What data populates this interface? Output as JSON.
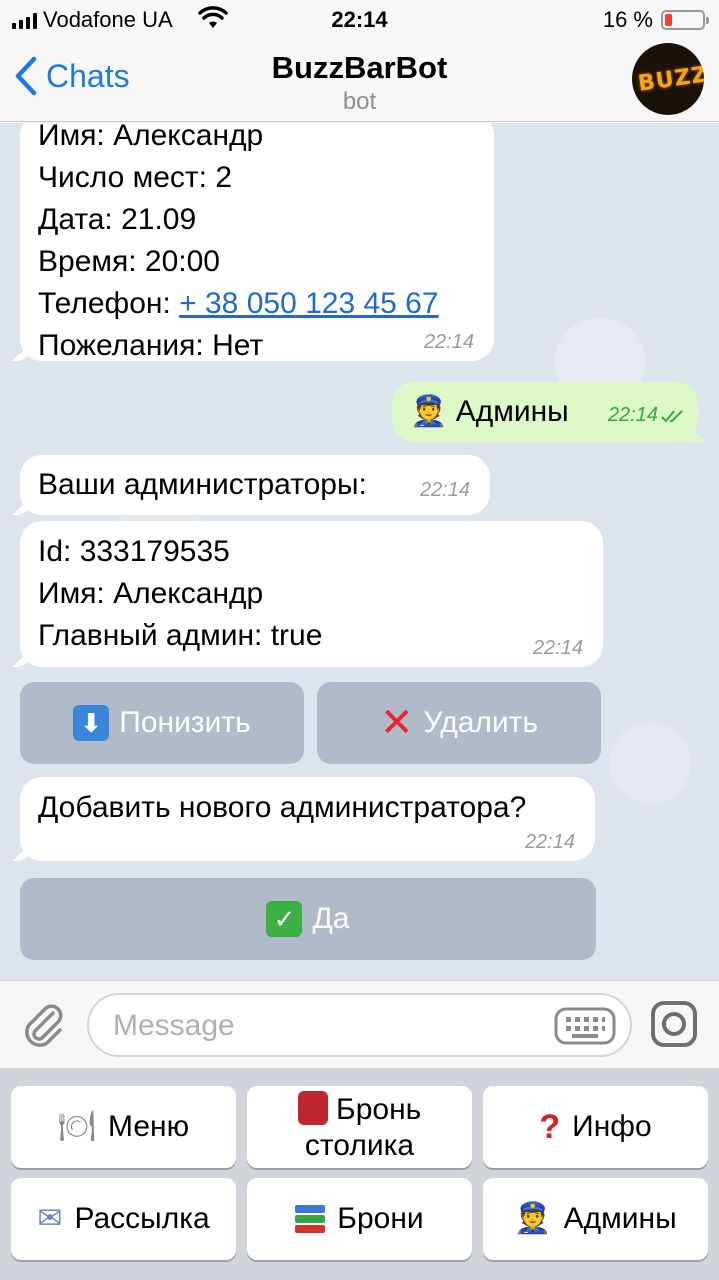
{
  "status_bar": {
    "carrier": "Vodafone UA",
    "time": "22:14",
    "battery": "16 %",
    "battery_level": 0.16
  },
  "nav": {
    "back_label": "Chats",
    "title": "BuzzBarBot",
    "subtitle": "bot",
    "avatar_text": "BUZZ"
  },
  "messages": {
    "booking": {
      "name": "Имя: Александр",
      "seats": "Число мест: 2",
      "date": "Дата: 21.09",
      "time_line": "Время: 20:00",
      "phone_label": "Телефон:",
      "phone": "+ 38 050 123 45 67",
      "wishes": "Пожелания: Нет",
      "timestamp": "22:14"
    },
    "admins_sent": {
      "text": "Админы",
      "timestamp": "22:14"
    },
    "admins_header": {
      "text": "Ваши администраторы:",
      "timestamp": "22:14"
    },
    "admin_info": {
      "id": "Id: 333179535",
      "name": "Имя: Александр",
      "main": "Главный админ: true",
      "timestamp": "22:14"
    },
    "add_prompt": {
      "text": "Добавить нового администратора?",
      "timestamp": "22:14"
    }
  },
  "inline_buttons": {
    "demote": "Понизить",
    "delete": "Удалить",
    "yes": "Да"
  },
  "input": {
    "placeholder": "Message"
  },
  "reply_keyboard": {
    "menu": "Меню",
    "booking_line1": "Бронь",
    "booking_line2": "столика",
    "info": "Инфо",
    "mailing": "Рассылка",
    "bookings": "Брони",
    "admins": "Админы"
  },
  "icons": [
    "signal-icon",
    "wifi-icon",
    "battery-icon",
    "back-chevron-icon",
    "police-officer-emoji",
    "arrow-down-emoji",
    "cross-mark-emoji",
    "check-mark-emoji",
    "paperclip-icon",
    "keyboard-icon",
    "instagram-camera-icon",
    "fork-knife-plate-emoji",
    "red-book-emoji",
    "question-mark-emoji",
    "envelope-tray-emoji",
    "books-emoji"
  ],
  "colors": {
    "accent": "#1f7ae0",
    "outgoing_bubble": "#dcf8c6",
    "chat_bg": "#dde4ec",
    "link": "#1f6cc8"
  }
}
